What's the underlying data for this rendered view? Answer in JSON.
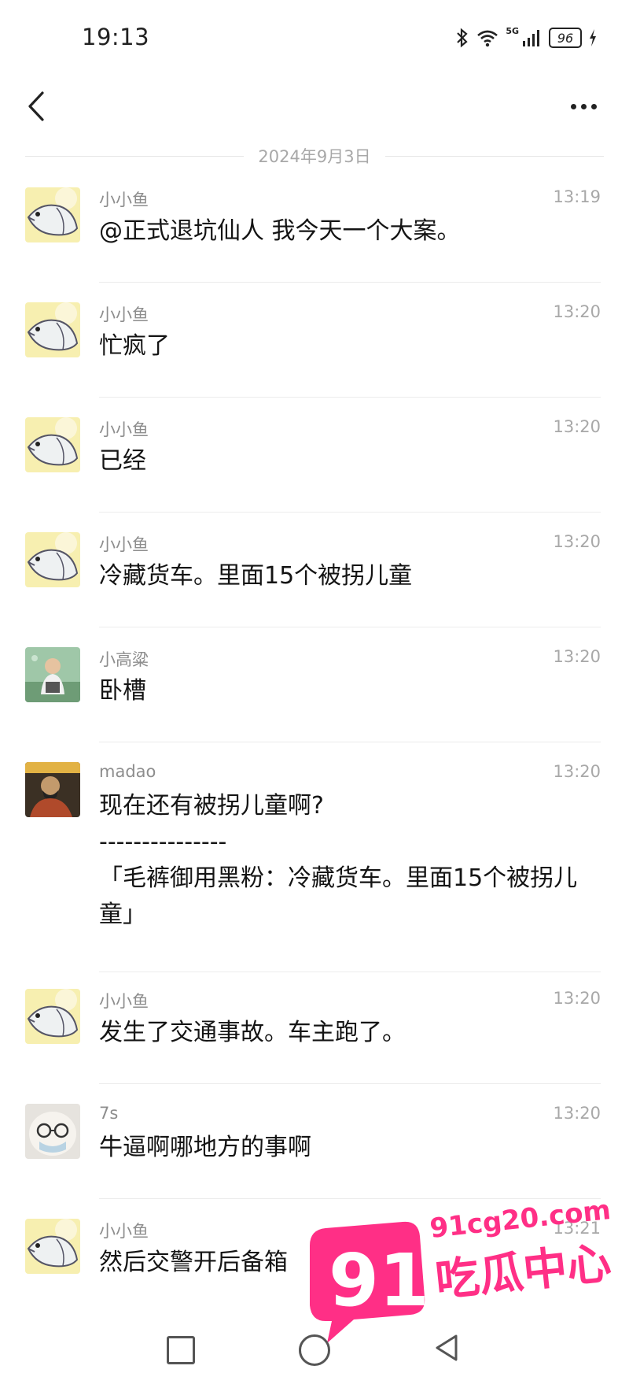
{
  "status_bar": {
    "time": "19:13",
    "network": "5G",
    "battery": "96"
  },
  "nav": {
    "back_label": "back",
    "more_label": "more"
  },
  "date_divider": "2024年9月3日",
  "messages": [
    {
      "sender": "小小鱼",
      "time": "13:19",
      "text": "@正式退坑仙人 我今天一个大案。",
      "avatar": "fish-avatar"
    },
    {
      "sender": "小小鱼",
      "time": "13:20",
      "text": "忙疯了",
      "avatar": "fish-avatar"
    },
    {
      "sender": "小小鱼",
      "time": "13:20",
      "text": "已经",
      "avatar": "fish-avatar"
    },
    {
      "sender": "小小鱼",
      "time": "13:20",
      "text": "冷藏货车。里面15个被拐儿童",
      "avatar": "fish-avatar"
    },
    {
      "sender": "小高粱",
      "time": "13:20",
      "text": "卧槽",
      "avatar": "child-photo-avatar"
    },
    {
      "sender": "madao",
      "time": "13:20",
      "text": "现在还有被拐儿童啊?",
      "quote_divider": "---------------",
      "quote": "「毛裤御用黑粉：冷藏货车。里面15个被拐儿童」",
      "avatar": "portrait-avatar"
    },
    {
      "sender": "小小鱼",
      "time": "13:20",
      "text": "发生了交通事故。车主跑了。",
      "avatar": "fish-avatar"
    },
    {
      "sender": "7s",
      "time": "13:20",
      "text": "牛逼啊哪地方的事啊",
      "avatar": "glasses-avatar"
    },
    {
      "sender": "小小鱼",
      "time": "13:21",
      "text": "然后交警开后备箱",
      "avatar": "fish-avatar"
    }
  ],
  "watermark": {
    "number": "91",
    "site": "91cg20.com",
    "label": "吃瓜中心"
  },
  "colors": {
    "watermark_pink": "#ff2f86",
    "text": "#141414",
    "muted": "#a8a8a8"
  }
}
